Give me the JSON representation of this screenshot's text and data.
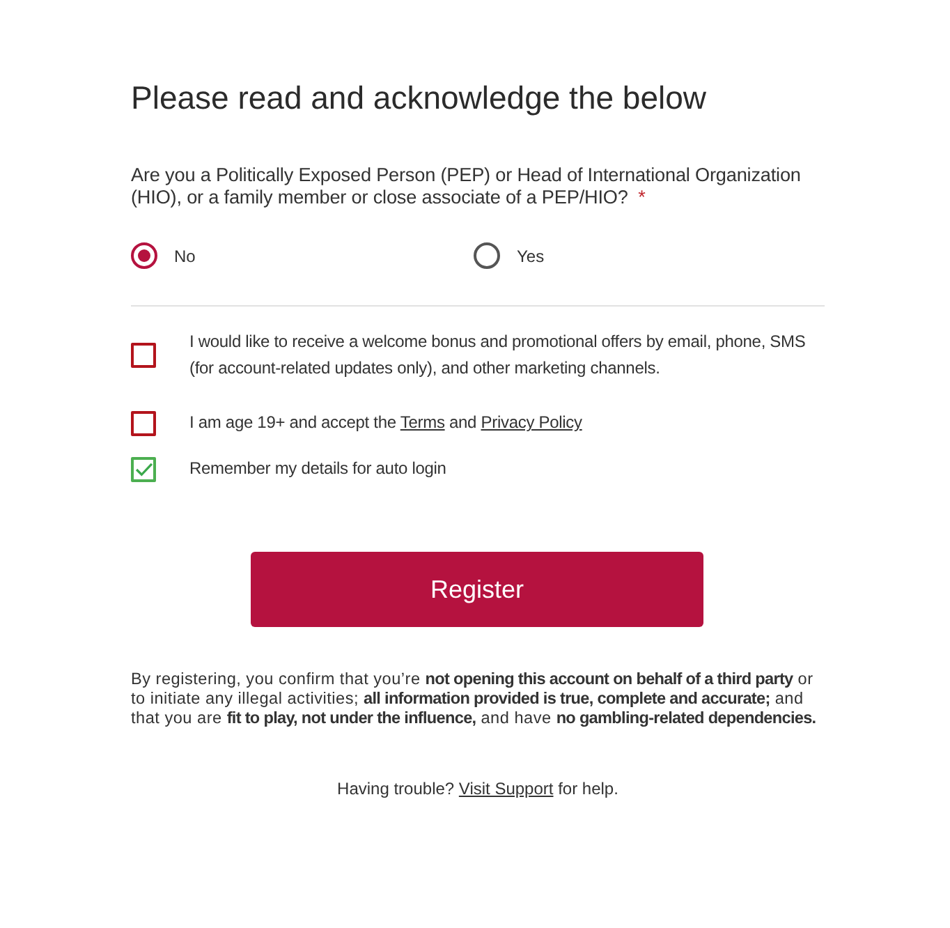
{
  "heading": "Please read and acknowledge the below",
  "pep_question": {
    "label": "Are you a Politically Exposed Person (PEP) or Head of International Organization (HIO), or a family member or close associate of a PEP/HIO?",
    "required_mark": "*",
    "options": [
      {
        "label": "No",
        "selected": true
      },
      {
        "label": "Yes",
        "selected": false
      }
    ]
  },
  "consents": [
    {
      "checked": false,
      "segments": [
        {
          "kind": "text",
          "text": "I would like to receive a welcome bonus and promotional offers by email, phone, SMS (for account-related updates only), and other marketing channels."
        }
      ]
    },
    {
      "checked": false,
      "segments": [
        {
          "kind": "text",
          "text": "I am age 19+ and accept the "
        },
        {
          "kind": "link",
          "text": "Terms"
        },
        {
          "kind": "text",
          "text": " and "
        },
        {
          "kind": "link",
          "text": "Privacy Policy"
        }
      ]
    },
    {
      "checked": true,
      "segments": [
        {
          "kind": "text",
          "text": "Remember my details for auto login"
        }
      ]
    }
  ],
  "register_button": "Register",
  "disclaimer": "By registering, you confirm that you’re **not opening this account on behalf of a third party** or to initiate any illegal activities; **all information provided is true, complete and accurate;** and that you are **fit to play, not under the influence,** and have **no gambling-related dependencies.**",
  "help": [
    {
      "kind": "text",
      "text": "Having trouble? "
    },
    {
      "kind": "link",
      "text": "Visit Support"
    },
    {
      "kind": "text",
      "text": " for help."
    }
  ]
}
